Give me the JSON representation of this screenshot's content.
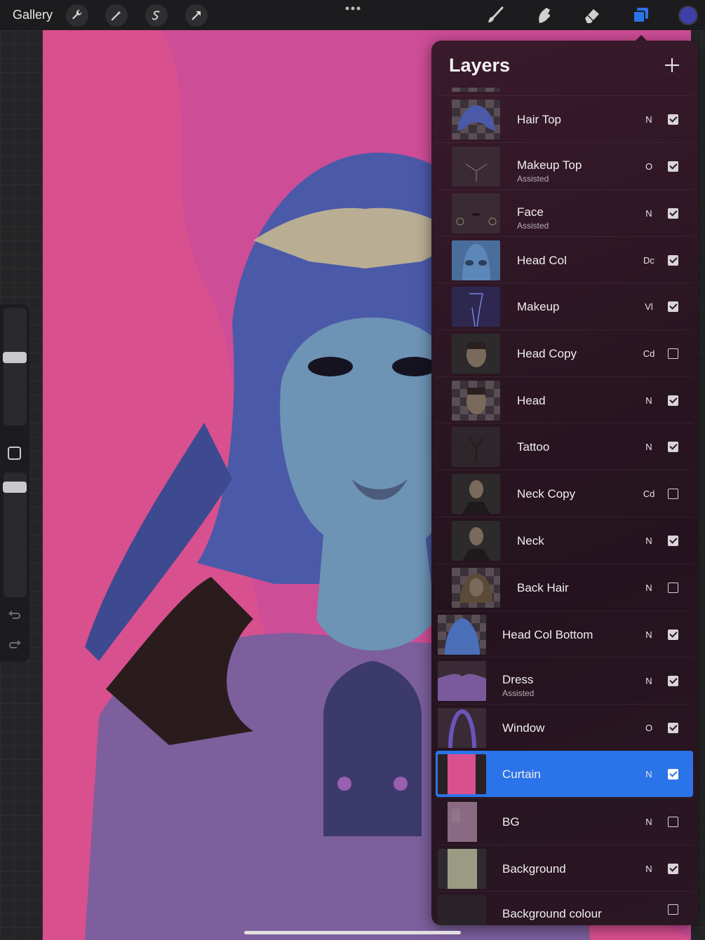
{
  "toolbar": {
    "gallery_label": "Gallery",
    "left_tools": [
      "wrench-icon",
      "magic-wand-icon",
      "selection-icon",
      "transform-arrow-icon"
    ],
    "right_tools": [
      "brush-icon",
      "smudge-icon",
      "eraser-icon",
      "layers-icon"
    ],
    "active_tool": "layers-icon",
    "current_color": "#3e3fa8",
    "accent_color": "#2b73e8"
  },
  "layers_panel": {
    "title": "Layers",
    "add_icon": "plus-icon",
    "layers": [
      {
        "name": "Hair Top",
        "sub": "",
        "blend": "N",
        "visible": true,
        "selected": false
      },
      {
        "name": "Makeup Top",
        "sub": "Assisted",
        "blend": "O",
        "visible": true,
        "selected": false
      },
      {
        "name": "Face",
        "sub": "Assisted",
        "blend": "N",
        "visible": true,
        "selected": false
      },
      {
        "name": "Head Col",
        "sub": "",
        "blend": "Dc",
        "visible": true,
        "selected": false
      },
      {
        "name": "Makeup",
        "sub": "",
        "blend": "Vl",
        "visible": true,
        "selected": false
      },
      {
        "name": "Head Copy",
        "sub": "",
        "blend": "Cd",
        "visible": false,
        "selected": false
      },
      {
        "name": "Head",
        "sub": "",
        "blend": "N",
        "visible": true,
        "selected": false
      },
      {
        "name": "Tattoo",
        "sub": "",
        "blend": "N",
        "visible": true,
        "selected": false
      },
      {
        "name": "Neck Copy",
        "sub": "",
        "blend": "Cd",
        "visible": false,
        "selected": false
      },
      {
        "name": "Neck",
        "sub": "",
        "blend": "N",
        "visible": true,
        "selected": false
      },
      {
        "name": "Back Hair",
        "sub": "",
        "blend": "N",
        "visible": false,
        "selected": false
      },
      {
        "name": "Head Col Bottom",
        "sub": "",
        "blend": "N",
        "visible": true,
        "selected": false
      },
      {
        "name": "Dress",
        "sub": "Assisted",
        "blend": "N",
        "visible": true,
        "selected": false
      },
      {
        "name": "Window",
        "sub": "",
        "blend": "O",
        "visible": true,
        "selected": false
      },
      {
        "name": "Curtain",
        "sub": "",
        "blend": "N",
        "visible": true,
        "selected": true
      },
      {
        "name": "BG",
        "sub": "",
        "blend": "N",
        "visible": false,
        "selected": false
      },
      {
        "name": "Background",
        "sub": "",
        "blend": "N",
        "visible": true,
        "selected": false
      },
      {
        "name": "Background colour",
        "sub": "",
        "blend": "",
        "visible": false,
        "selected": false
      }
    ]
  }
}
